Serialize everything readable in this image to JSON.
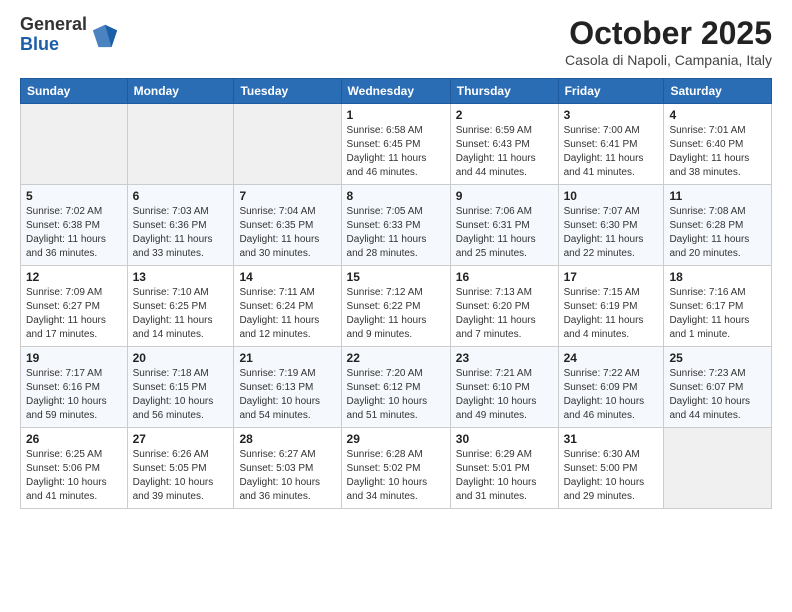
{
  "header": {
    "logo_general": "General",
    "logo_blue": "Blue",
    "month_title": "October 2025",
    "location": "Casola di Napoli, Campania, Italy"
  },
  "weekdays": [
    "Sunday",
    "Monday",
    "Tuesday",
    "Wednesday",
    "Thursday",
    "Friday",
    "Saturday"
  ],
  "weeks": [
    [
      {
        "day": "",
        "info": ""
      },
      {
        "day": "",
        "info": ""
      },
      {
        "day": "",
        "info": ""
      },
      {
        "day": "1",
        "info": "Sunrise: 6:58 AM\nSunset: 6:45 PM\nDaylight: 11 hours and 46 minutes."
      },
      {
        "day": "2",
        "info": "Sunrise: 6:59 AM\nSunset: 6:43 PM\nDaylight: 11 hours and 44 minutes."
      },
      {
        "day": "3",
        "info": "Sunrise: 7:00 AM\nSunset: 6:41 PM\nDaylight: 11 hours and 41 minutes."
      },
      {
        "day": "4",
        "info": "Sunrise: 7:01 AM\nSunset: 6:40 PM\nDaylight: 11 hours and 38 minutes."
      }
    ],
    [
      {
        "day": "5",
        "info": "Sunrise: 7:02 AM\nSunset: 6:38 PM\nDaylight: 11 hours and 36 minutes."
      },
      {
        "day": "6",
        "info": "Sunrise: 7:03 AM\nSunset: 6:36 PM\nDaylight: 11 hours and 33 minutes."
      },
      {
        "day": "7",
        "info": "Sunrise: 7:04 AM\nSunset: 6:35 PM\nDaylight: 11 hours and 30 minutes."
      },
      {
        "day": "8",
        "info": "Sunrise: 7:05 AM\nSunset: 6:33 PM\nDaylight: 11 hours and 28 minutes."
      },
      {
        "day": "9",
        "info": "Sunrise: 7:06 AM\nSunset: 6:31 PM\nDaylight: 11 hours and 25 minutes."
      },
      {
        "day": "10",
        "info": "Sunrise: 7:07 AM\nSunset: 6:30 PM\nDaylight: 11 hours and 22 minutes."
      },
      {
        "day": "11",
        "info": "Sunrise: 7:08 AM\nSunset: 6:28 PM\nDaylight: 11 hours and 20 minutes."
      }
    ],
    [
      {
        "day": "12",
        "info": "Sunrise: 7:09 AM\nSunset: 6:27 PM\nDaylight: 11 hours and 17 minutes."
      },
      {
        "day": "13",
        "info": "Sunrise: 7:10 AM\nSunset: 6:25 PM\nDaylight: 11 hours and 14 minutes."
      },
      {
        "day": "14",
        "info": "Sunrise: 7:11 AM\nSunset: 6:24 PM\nDaylight: 11 hours and 12 minutes."
      },
      {
        "day": "15",
        "info": "Sunrise: 7:12 AM\nSunset: 6:22 PM\nDaylight: 11 hours and 9 minutes."
      },
      {
        "day": "16",
        "info": "Sunrise: 7:13 AM\nSunset: 6:20 PM\nDaylight: 11 hours and 7 minutes."
      },
      {
        "day": "17",
        "info": "Sunrise: 7:15 AM\nSunset: 6:19 PM\nDaylight: 11 hours and 4 minutes."
      },
      {
        "day": "18",
        "info": "Sunrise: 7:16 AM\nSunset: 6:17 PM\nDaylight: 11 hours and 1 minute."
      }
    ],
    [
      {
        "day": "19",
        "info": "Sunrise: 7:17 AM\nSunset: 6:16 PM\nDaylight: 10 hours and 59 minutes."
      },
      {
        "day": "20",
        "info": "Sunrise: 7:18 AM\nSunset: 6:15 PM\nDaylight: 10 hours and 56 minutes."
      },
      {
        "day": "21",
        "info": "Sunrise: 7:19 AM\nSunset: 6:13 PM\nDaylight: 10 hours and 54 minutes."
      },
      {
        "day": "22",
        "info": "Sunrise: 7:20 AM\nSunset: 6:12 PM\nDaylight: 10 hours and 51 minutes."
      },
      {
        "day": "23",
        "info": "Sunrise: 7:21 AM\nSunset: 6:10 PM\nDaylight: 10 hours and 49 minutes."
      },
      {
        "day": "24",
        "info": "Sunrise: 7:22 AM\nSunset: 6:09 PM\nDaylight: 10 hours and 46 minutes."
      },
      {
        "day": "25",
        "info": "Sunrise: 7:23 AM\nSunset: 6:07 PM\nDaylight: 10 hours and 44 minutes."
      }
    ],
    [
      {
        "day": "26",
        "info": "Sunrise: 6:25 AM\nSunset: 5:06 PM\nDaylight: 10 hours and 41 minutes."
      },
      {
        "day": "27",
        "info": "Sunrise: 6:26 AM\nSunset: 5:05 PM\nDaylight: 10 hours and 39 minutes."
      },
      {
        "day": "28",
        "info": "Sunrise: 6:27 AM\nSunset: 5:03 PM\nDaylight: 10 hours and 36 minutes."
      },
      {
        "day": "29",
        "info": "Sunrise: 6:28 AM\nSunset: 5:02 PM\nDaylight: 10 hours and 34 minutes."
      },
      {
        "day": "30",
        "info": "Sunrise: 6:29 AM\nSunset: 5:01 PM\nDaylight: 10 hours and 31 minutes."
      },
      {
        "day": "31",
        "info": "Sunrise: 6:30 AM\nSunset: 5:00 PM\nDaylight: 10 hours and 29 minutes."
      },
      {
        "day": "",
        "info": ""
      }
    ]
  ]
}
